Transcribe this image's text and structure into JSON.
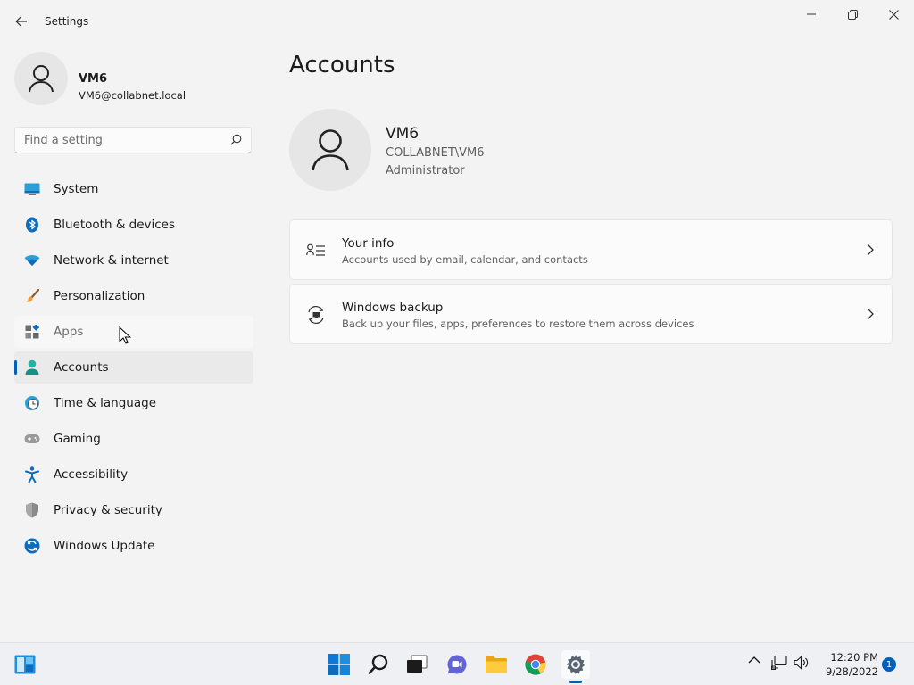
{
  "window": {
    "title": "Settings"
  },
  "profile": {
    "name": "VM6",
    "email": "VM6@collabnet.local"
  },
  "search": {
    "placeholder": "Find a setting"
  },
  "sidebar": {
    "items": [
      {
        "label": "System",
        "icon": "system-icon"
      },
      {
        "label": "Bluetooth & devices",
        "icon": "bluetooth-icon"
      },
      {
        "label": "Network & internet",
        "icon": "wifi-icon"
      },
      {
        "label": "Personalization",
        "icon": "brush-icon"
      },
      {
        "label": "Apps",
        "icon": "apps-icon"
      },
      {
        "label": "Accounts",
        "icon": "accounts-icon"
      },
      {
        "label": "Time & language",
        "icon": "clock-globe-icon"
      },
      {
        "label": "Gaming",
        "icon": "gamepad-icon"
      },
      {
        "label": "Accessibility",
        "icon": "accessibility-icon"
      },
      {
        "label": "Privacy & security",
        "icon": "shield-icon"
      },
      {
        "label": "Windows Update",
        "icon": "update-icon"
      }
    ],
    "active": "Accounts",
    "hovered": "Apps"
  },
  "main": {
    "title": "Accounts",
    "account": {
      "name": "VM6",
      "domain": "COLLABNET\\VM6",
      "role": "Administrator"
    },
    "cards": [
      {
        "title": "Your info",
        "subtitle": "Accounts used by email, calendar, and contacts",
        "icon": "your-info-icon"
      },
      {
        "title": "Windows backup",
        "subtitle": "Back up your files, apps, preferences to restore them across devices",
        "icon": "backup-icon"
      }
    ]
  },
  "taskbar": {
    "apps": [
      "widgets-icon",
      "start-icon",
      "search-icon",
      "task-view-icon",
      "chat-icon",
      "file-explorer-icon",
      "chrome-icon",
      "settings-icon"
    ],
    "clock_time": "12:20 PM",
    "clock_date": "9/28/2022",
    "notification_count": "1"
  },
  "colors": {
    "accent": "#005fb8",
    "background": "#f3f3f3",
    "card": "#fbfbfb"
  }
}
